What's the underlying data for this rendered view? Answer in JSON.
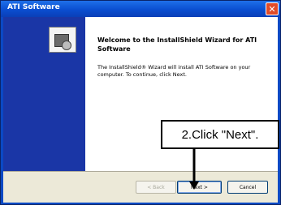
{
  "window": {
    "title": "ATI Software",
    "close_glyph": "✕"
  },
  "wizard": {
    "heading": "Welcome to the InstallShield Wizard for ATI Software",
    "body": "The InstallShield® Wizard will install ATI Software on your computer. To continue, click Next."
  },
  "buttons": {
    "back": "< Back",
    "next": "Next >",
    "cancel": "Cancel"
  },
  "annotation": {
    "callout": "2.Click \"Next\"."
  },
  "colors": {
    "titlebar": "#0a4ed0",
    "side_panel": "#1a36a6",
    "footer": "#ece9d8",
    "close_button": "#e04b28"
  },
  "icons": {
    "close": "close-icon",
    "installer": "install-package-icon",
    "arrow": "down-arrow-icon"
  }
}
